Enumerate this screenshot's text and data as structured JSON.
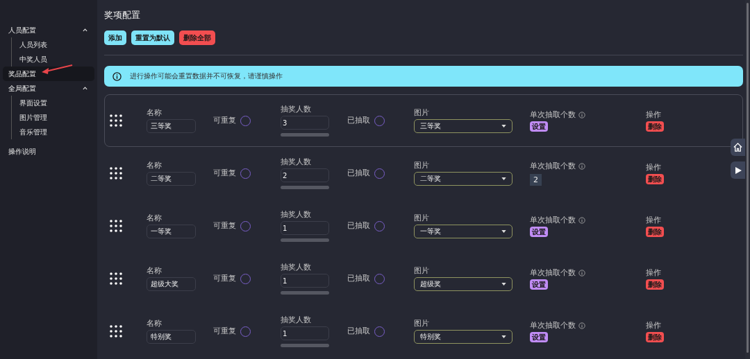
{
  "sidebar": {
    "items": [
      {
        "label": "人员配置",
        "selected": false,
        "expanded": true,
        "children": [
          {
            "label": "人员列表"
          },
          {
            "label": "中奖人员"
          }
        ]
      },
      {
        "label": "奖品配置",
        "selected": true
      },
      {
        "label": "全局配置",
        "selected": false,
        "expanded": true,
        "children": [
          {
            "label": "界面设置"
          },
          {
            "label": "图片管理"
          },
          {
            "label": "音乐管理"
          }
        ]
      },
      {
        "label": "操作说明",
        "selected": false
      }
    ]
  },
  "page_title": "奖项配置",
  "toolbar": [
    {
      "label": "添加",
      "kind": "primary"
    },
    {
      "label": "重置为默认",
      "kind": "primary"
    },
    {
      "label": "删除全部",
      "kind": "danger"
    }
  ],
  "alert": {
    "text": "进行操作可能会重置数据并不可恢复，请谨慎操作"
  },
  "prizes": [
    {
      "highlighted": true,
      "name_label": "名称",
      "name": "三等奖",
      "repeat_label": "可重复",
      "repeat": false,
      "count_label": "抽奖人数",
      "count": "3",
      "drawn_label": "已抽取",
      "drawn": false,
      "picture_label": "图片",
      "picture": "三等奖",
      "single_label": "单次抽取个数",
      "single": {
        "kind": "button",
        "text": "设置"
      },
      "action_label": "操作",
      "delete": "删除"
    },
    {
      "highlighted": false,
      "name_label": "名称",
      "name": "二等奖",
      "repeat_label": "可重复",
      "repeat": false,
      "count_label": "抽奖人数",
      "count": "2",
      "drawn_label": "已抽取",
      "drawn": false,
      "picture_label": "图片",
      "picture": "二等奖",
      "single_label": "单次抽取个数",
      "single": {
        "kind": "value",
        "text": "2"
      },
      "action_label": "操作",
      "delete": "删除"
    },
    {
      "highlighted": false,
      "name_label": "名称",
      "name": "一等奖",
      "repeat_label": "可重复",
      "repeat": false,
      "count_label": "抽奖人数",
      "count": "1",
      "drawn_label": "已抽取",
      "drawn": false,
      "picture_label": "图片",
      "picture": "一等奖",
      "single_label": "单次抽取个数",
      "single": {
        "kind": "button",
        "text": "设置"
      },
      "action_label": "操作",
      "delete": "删除"
    },
    {
      "highlighted": false,
      "name_label": "名称",
      "name": "超级大奖",
      "repeat_label": "可重复",
      "repeat": false,
      "count_label": "抽奖人数",
      "count": "1",
      "drawn_label": "已抽取",
      "drawn": false,
      "picture_label": "图片",
      "picture": "超级奖",
      "single_label": "单次抽取个数",
      "single": {
        "kind": "button",
        "text": "设置"
      },
      "action_label": "操作",
      "delete": "删除"
    },
    {
      "highlighted": false,
      "name_label": "名称",
      "name": "特别奖",
      "repeat_label": "可重复",
      "repeat": false,
      "count_label": "抽奖人数",
      "count": "1",
      "drawn_label": "已抽取",
      "drawn": false,
      "picture_label": "图片",
      "picture": "特别奖",
      "single_label": "单次抽取个数",
      "single": {
        "kind": "button",
        "text": "设置"
      },
      "action_label": "操作",
      "delete": "删除"
    }
  ]
}
